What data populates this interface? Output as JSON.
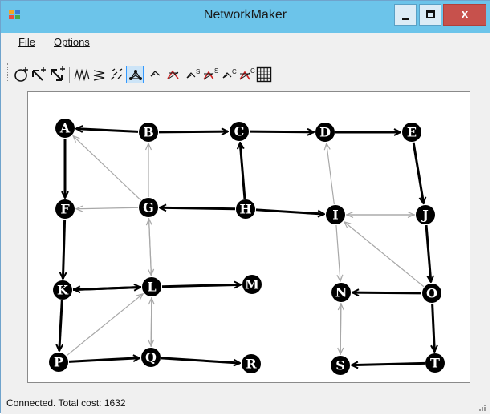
{
  "window": {
    "title": "NetworkMaker",
    "close_glyph": "x"
  },
  "menu": [
    "File",
    "Options"
  ],
  "toolbar": {
    "tools": [
      {
        "id": "add-node",
        "icon": "add-node-icon"
      },
      {
        "id": "add-link",
        "icon": "add-link-icon"
      },
      {
        "id": "add-two-way-link",
        "icon": "add-two-way-link-icon"
      },
      {
        "id": "tool4",
        "icon": "zigzag-icon"
      },
      {
        "id": "tool5",
        "icon": "stacked-zigzag-icon"
      },
      {
        "id": "tool6",
        "icon": "scatter-icon"
      },
      {
        "id": "tool7",
        "icon": "network-icon",
        "active": true
      },
      {
        "id": "tool8",
        "icon": "path-icon"
      },
      {
        "id": "tool9",
        "icon": "red-path-icon"
      },
      {
        "id": "tool10",
        "icon": "path-s-icon"
      },
      {
        "id": "tool11",
        "icon": "red-path-s-icon"
      },
      {
        "id": "tool12",
        "icon": "path-c-icon"
      },
      {
        "id": "tool13",
        "icon": "red-path-c-icon"
      },
      {
        "id": "tool14",
        "icon": "grid-icon"
      }
    ]
  },
  "network": {
    "nodes": [
      "A",
      "B",
      "C",
      "D",
      "E",
      "F",
      "G",
      "H",
      "I",
      "J",
      "K",
      "L",
      "M",
      "N",
      "O",
      "P",
      "Q",
      "R",
      "S",
      "T"
    ],
    "bold_links": [
      [
        "B",
        "A"
      ],
      [
        "A",
        "F"
      ],
      [
        "B",
        "C"
      ],
      [
        "C",
        "D"
      ],
      [
        "D",
        "E"
      ],
      [
        "E",
        "J"
      ],
      [
        "H",
        "C"
      ],
      [
        "H",
        "G"
      ],
      [
        "H",
        "I"
      ],
      [
        "F",
        "K"
      ],
      [
        "K",
        "L"
      ],
      [
        "L",
        "K"
      ],
      [
        "K",
        "P"
      ],
      [
        "L",
        "M"
      ],
      [
        "P",
        "Q"
      ],
      [
        "Q",
        "R"
      ],
      [
        "J",
        "O"
      ],
      [
        "O",
        "N"
      ],
      [
        "O",
        "T"
      ],
      [
        "T",
        "S"
      ]
    ],
    "light_links": [
      [
        "G",
        "A"
      ],
      [
        "G",
        "B"
      ],
      [
        "G",
        "F"
      ],
      [
        "I",
        "D"
      ],
      [
        "I",
        "J"
      ],
      [
        "J",
        "I"
      ],
      [
        "I",
        "N"
      ],
      [
        "O",
        "I"
      ],
      [
        "L",
        "G"
      ],
      [
        "G",
        "L"
      ],
      [
        "P",
        "L"
      ],
      [
        "Q",
        "L"
      ],
      [
        "L",
        "Q"
      ],
      [
        "N",
        "S"
      ],
      [
        "S",
        "N"
      ]
    ]
  },
  "status": {
    "text": "Connected. Total cost: 1632"
  },
  "colors": {
    "titlebar": "#6cc4ea",
    "close": "#c7514c",
    "node_fill": "#000000",
    "bold_link": "#000000",
    "light_link": "#a8a8a8"
  }
}
